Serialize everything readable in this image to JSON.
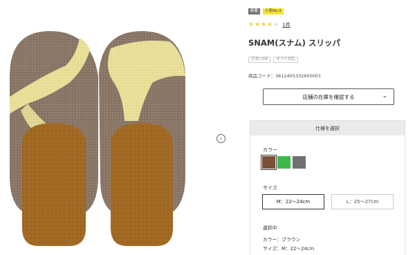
{
  "badges": {
    "new": "新着",
    "rank": "人気No.3"
  },
  "rating": {
    "stars": 4,
    "max": 5,
    "count": "1件",
    "color": "#f0d03c"
  },
  "product": {
    "title": "SNAM(スナム) スリッパ",
    "tags": [
      "手洗いOK",
      "ギフト対応"
    ],
    "code": "商品コード：3612405332650001",
    "image_icon": "slippers-image"
  },
  "stock": {
    "label": "店舗の在庫を確認する",
    "icon": "chevron-down-icon"
  },
  "spec": {
    "header": "仕様を選択",
    "color_label": "カラー",
    "colors": [
      {
        "name": "brown",
        "hex": "#7a5036",
        "selected": true
      },
      {
        "name": "green",
        "hex": "#3eb84a",
        "selected": false
      },
      {
        "name": "gray",
        "hex": "#6f7070",
        "selected": false
      }
    ],
    "size_label": "サイズ",
    "sizes": [
      {
        "label": "M：22〜24cm",
        "selected": true
      },
      {
        "label": "L：25〜27cm",
        "selected": false
      }
    ],
    "selected_heading": "選択中",
    "selected_color": "カラー：ブラウン",
    "selected_size": "サイズ：M：22〜24cm"
  },
  "gallery": {
    "next_icon": "chevron-right-icon",
    "next_glyph": "›"
  }
}
